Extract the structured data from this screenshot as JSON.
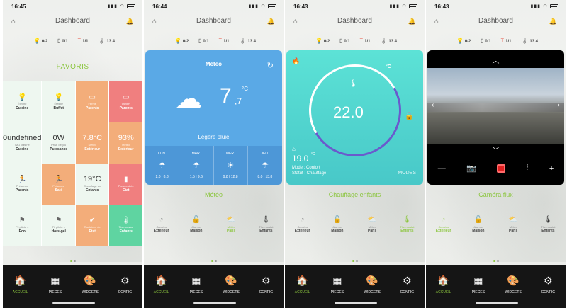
{
  "screens": [
    {
      "time": "16:45",
      "header_title": "Dashboard",
      "stats": [
        {
          "icon": "💡",
          "value": "0/2"
        },
        {
          "icon": "▯",
          "value": "0/1"
        },
        {
          "icon": "⌶",
          "value": "1/1",
          "red": true
        },
        {
          "icon": "🌡",
          "value": "13.4"
        }
      ],
      "section_title": "FAVORIS",
      "tiles": [
        {
          "style": "",
          "icon": "💡",
          "value": "",
          "sub": "Éteinte",
          "label": "Cuisine"
        },
        {
          "style": "",
          "icon": "💡",
          "value": "",
          "sub": "Éteinte",
          "label": "Buffet"
        },
        {
          "style": "orange",
          "icon": "▭",
          "value": "",
          "sub": "Fermé",
          "label": "Parents"
        },
        {
          "style": "red",
          "icon": "▭",
          "value": "",
          "sub": "Ouvert",
          "label": "Parents"
        },
        {
          "style": "",
          "icon": "",
          "value": "0undefined",
          "sub": "IMG cuisine",
          "label": "Cuisine"
        },
        {
          "style": "",
          "icon": "",
          "value": "0W",
          "sub": "Prise de jou",
          "label": "Puissance"
        },
        {
          "style": "orange",
          "icon": "",
          "value": "7.8°C",
          "sub": "Météo",
          "label": "Extérieur"
        },
        {
          "style": "orange",
          "icon": "",
          "value": "93%",
          "sub": "Météo",
          "label": "Extérieur"
        },
        {
          "style": "",
          "icon": "🏃",
          "value": "",
          "sub": "Présence",
          "label": "Parents"
        },
        {
          "style": "orange",
          "icon": "🏃",
          "value": "",
          "sub": "Présence",
          "label": "Salé"
        },
        {
          "style": "",
          "icon": "",
          "value": "19°C",
          "sub": "Chauffage en",
          "label": "Enfants"
        },
        {
          "style": "red",
          "icon": "▮",
          "value": "",
          "sub": "Porte entrée",
          "label": "État"
        },
        {
          "style": "",
          "icon": "⚑",
          "value": "",
          "sub": "Fil pilote s",
          "label": "Eco"
        },
        {
          "style": "",
          "icon": "⚑",
          "value": "",
          "sub": "Fil pilote c",
          "label": "Hors-gel"
        },
        {
          "style": "orange",
          "icon": "✔",
          "value": "",
          "sub": "Radiateur de",
          "label": "État"
        },
        {
          "style": "green",
          "icon": "🌡",
          "value": "",
          "sub": "Thermostat",
          "label": "Enfants"
        }
      ]
    },
    {
      "time": "16:44",
      "header_title": "Dashboard",
      "stats": [
        {
          "icon": "💡",
          "value": "0/2"
        },
        {
          "icon": "▯",
          "value": "0/1"
        },
        {
          "icon": "⌶",
          "value": "1/1",
          "red": true
        },
        {
          "icon": "🌡",
          "value": "13.4"
        }
      ],
      "weather": {
        "title": "Météo",
        "temp": "7",
        "temp_dec": ",7",
        "unit": "°C",
        "description": "Légère pluie",
        "forecast": [
          {
            "day": "LUN.",
            "range": "2.0 | 8.8"
          },
          {
            "day": "MAR.",
            "range": "1.5 | 9.6"
          },
          {
            "day": "MER.",
            "range": "9.8 | 12.8"
          },
          {
            "day": "JEU.",
            "range": "8.0 | 13.8"
          }
        ]
      },
      "card_label": "Météo"
    },
    {
      "time": "16:43",
      "header_title": "Dashboard",
      "stats": [
        {
          "icon": "💡",
          "value": "0/2"
        },
        {
          "icon": "▯",
          "value": "0/1"
        },
        {
          "icon": "⌶",
          "value": "1/1",
          "red": true
        },
        {
          "icon": "🌡",
          "value": "13.4"
        }
      ],
      "thermostat": {
        "unit": "°C",
        "target": "22.0",
        "current": "19.0",
        "current_unit": "°C",
        "mode_line": "Mode : Confort",
        "status_line": "Statut : Chauffage",
        "modes_label": "MODES"
      },
      "card_label": "Chauffage enfants"
    },
    {
      "time": "16:43",
      "header_title": "Dashboard",
      "stats": [
        {
          "icon": "💡",
          "value": "0/2"
        },
        {
          "icon": "▯",
          "value": "0/1"
        },
        {
          "icon": "⌶",
          "value": "1/1",
          "red": true
        },
        {
          "icon": "🌡",
          "value": "13.4"
        }
      ],
      "card_label": "Caméra flux"
    }
  ],
  "devices": [
    {
      "sub": "Caméra",
      "label": "Extérieur"
    },
    {
      "sub": "Alarme",
      "label": "Maison"
    },
    {
      "sub": "Météo",
      "label": "Paris"
    },
    {
      "sub": "Thermostat",
      "label": "Enfants"
    }
  ],
  "tabs": [
    {
      "label": "ACCUEIL"
    },
    {
      "label": "PIÈCES"
    },
    {
      "label": "WIDGETS"
    },
    {
      "label": "CONFIG"
    }
  ],
  "colors": {
    "accent": "#8cc63f",
    "orange": "#f3ad7a",
    "red": "#f07f7f",
    "green": "#5fd4a1",
    "weather": "#5aa9e6",
    "thermostat": "#5ce2d6"
  }
}
